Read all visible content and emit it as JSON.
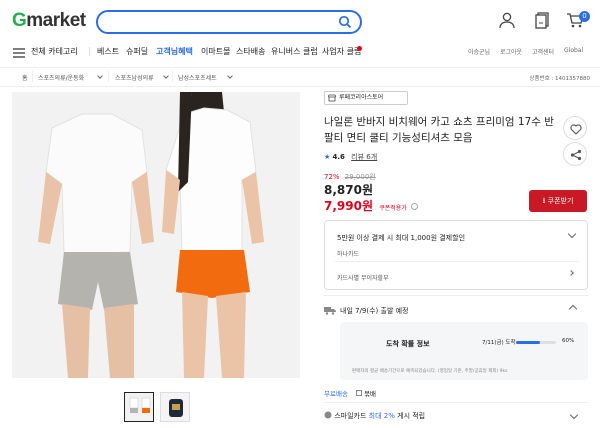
{
  "brand": {
    "logo_g": "G",
    "logo_rest": "market"
  },
  "search": {
    "placeholder": ""
  },
  "header": {
    "cart_count": "0"
  },
  "nav": {
    "menu_label": "전체 카테고리",
    "items": [
      "베스트",
      "슈퍼딜",
      "고객님혜택",
      "이마트몰",
      "스타배송",
      "유니버스 클럽",
      "사업자 클럽"
    ],
    "util": [
      "이승군님",
      "로그아웃",
      "고객센터",
      "Global"
    ]
  },
  "breadcrumb": {
    "home": "홈",
    "levels": [
      "스포츠의류/운동화",
      "스포츠남성의류",
      "남성스포츠세트"
    ],
    "product_number": "상품번호 : 1401357880"
  },
  "product": {
    "seller": "루페코리아스토어",
    "title": "나일론 반바지 비치웨어 카고 쇼츠 프리미엄 17수 반팔티 면티 쿨티 기능성티셔츠 모음",
    "rating": "4.6",
    "reviews": "리뷰 6개",
    "discount_rate": "72%",
    "original_price": "29,000원",
    "price": "8,870원",
    "coupon_price": "7,990원",
    "coupon_label": "쿠폰적용가",
    "coupon_button": "쿠폰받기"
  },
  "benefit": {
    "line1": "5만원 이상 결제 시 최대 1,000원 결제할인",
    "card": "하나카드",
    "interest": "카드사별 무이자할부"
  },
  "delivery": {
    "label": "내일 7/9(수) 출발 예정",
    "stats_title": "도착 확률 정보",
    "stats_date": "7/11(금) 도착",
    "stats_percent": "60%",
    "note": "판매자의 평균 배송기간으로 예측되었습니다. (영업일 기준, 주말/공휴일 제외) 9ks",
    "free": "무료배송",
    "pack": "묶배"
  },
  "smile": {
    "prefix": "스마일카드",
    "highlight": "최대 2%",
    "suffix": "게시 적립"
  },
  "colors": {
    "accent": "#2b6de5",
    "red": "#e5001b",
    "green": "#21b14b",
    "button_red": "#c81924"
  }
}
